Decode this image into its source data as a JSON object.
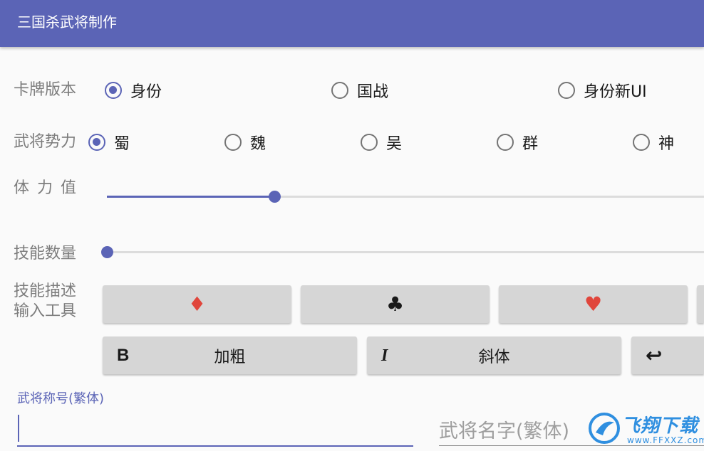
{
  "app": {
    "title": "三国杀武将制作"
  },
  "card_version": {
    "label": "卡牌版本",
    "options": [
      "身份",
      "国战",
      "身份新UI"
    ],
    "selected": "身份"
  },
  "faction": {
    "label": "武将势力",
    "options": [
      "蜀",
      "魏",
      "吴",
      "群",
      "神"
    ],
    "selected": "蜀"
  },
  "hp": {
    "label": "体 力 值",
    "value_fraction": 0.28
  },
  "skill_count": {
    "label": "技能数量",
    "value_fraction": 0.0
  },
  "skill_desc_tools": {
    "label_line1": "技能描述",
    "label_line2": "输入工具",
    "suit_buttons": [
      {
        "symbol": "♦",
        "icon": "diamond-icon",
        "color": "#e0463c"
      },
      {
        "symbol": "♣",
        "icon": "club-icon",
        "color": "#1a1a1a"
      },
      {
        "symbol": "♥",
        "icon": "heart-icon",
        "color": "#e0463c"
      }
    ],
    "format_buttons": [
      {
        "icon_text": "B",
        "label": "加粗",
        "icon": "bold-icon"
      },
      {
        "icon_text": "I",
        "label": "斜体",
        "icon": "italic-icon"
      },
      {
        "icon_text": "↩",
        "label": "",
        "icon": "enter-icon"
      }
    ]
  },
  "title_field": {
    "label": "武将称号(繁体)",
    "value": ""
  },
  "name_field": {
    "placeholder": "武将名字(繁体)",
    "value": ""
  },
  "watermark": {
    "text": "飞翔下载",
    "sub": "www.FFXXZ.com"
  },
  "colors": {
    "primary": "#5b64b6",
    "suit_red": "#e0463c",
    "button_bg": "#d6d6d6"
  }
}
